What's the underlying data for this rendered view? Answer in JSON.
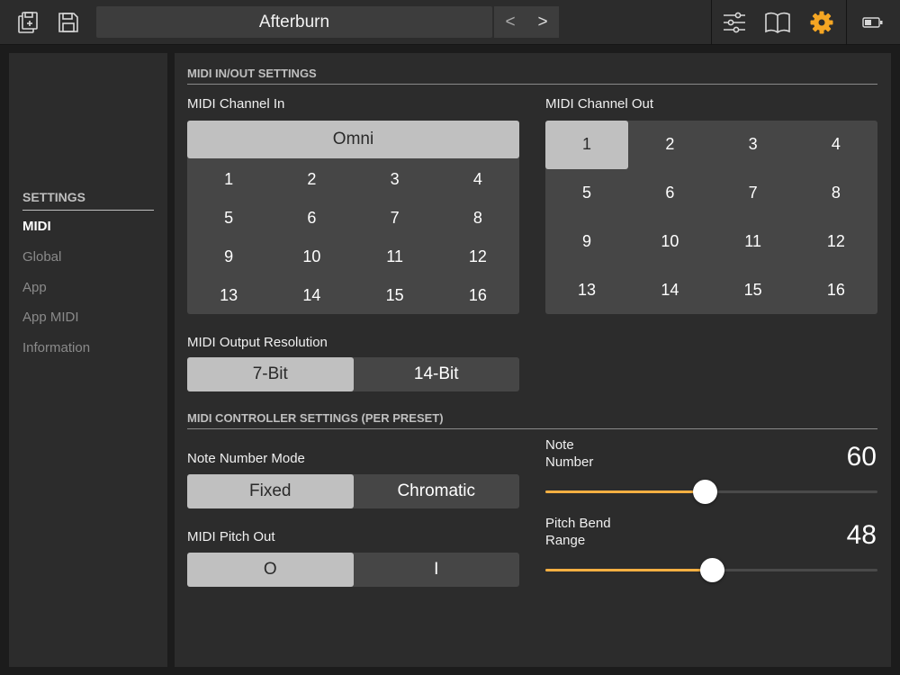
{
  "topbar": {
    "preset_name": "Afterburn",
    "prev_label": "<",
    "next_label": ">",
    "icons": [
      "preset-browser-icon",
      "save-icon",
      "mixer-sliders-icon",
      "manual-book-icon",
      "gear-icon",
      "battery-icon"
    ],
    "accent_color": "#f5a623"
  },
  "sidebar": {
    "heading": "SETTINGS",
    "items": [
      {
        "label": "MIDI",
        "active": true
      },
      {
        "label": "Global",
        "active": false
      },
      {
        "label": "App",
        "active": false
      },
      {
        "label": "App MIDI",
        "active": false
      },
      {
        "label": "Information",
        "active": false
      }
    ]
  },
  "midi_io": {
    "section_title": "MIDI IN/OUT SETTINGS",
    "channel_in": {
      "label": "MIDI Channel In",
      "omni_label": "Omni",
      "selected": "Omni",
      "channels": [
        "1",
        "2",
        "3",
        "4",
        "5",
        "6",
        "7",
        "8",
        "9",
        "10",
        "11",
        "12",
        "13",
        "14",
        "15",
        "16"
      ]
    },
    "channel_out": {
      "label": "MIDI Channel Out",
      "selected": "1",
      "channels": [
        "1",
        "2",
        "3",
        "4",
        "5",
        "6",
        "7",
        "8",
        "9",
        "10",
        "11",
        "12",
        "13",
        "14",
        "15",
        "16"
      ]
    },
    "output_resolution": {
      "label": "MIDI Output Resolution",
      "options": [
        "7-Bit",
        "14-Bit"
      ],
      "selected": "7-Bit"
    }
  },
  "controller": {
    "section_title": "MIDI CONTROLLER SETTINGS (PER PRESET)",
    "note_mode": {
      "label": "Note Number Mode",
      "options": [
        "Fixed",
        "Chromatic"
      ],
      "selected": "Fixed"
    },
    "pitch_out": {
      "label": "MIDI Pitch Out",
      "options": [
        "O",
        "I"
      ],
      "selected": "O"
    },
    "note_number": {
      "label_line1": "Note",
      "label_line2": "Number",
      "value": "60",
      "level": 0.48
    },
    "pitch_bend": {
      "label_line1": "Pitch Bend",
      "label_line2": "Range",
      "value": "48",
      "level": 0.5
    },
    "slider_fill_color": "#f5b042"
  }
}
